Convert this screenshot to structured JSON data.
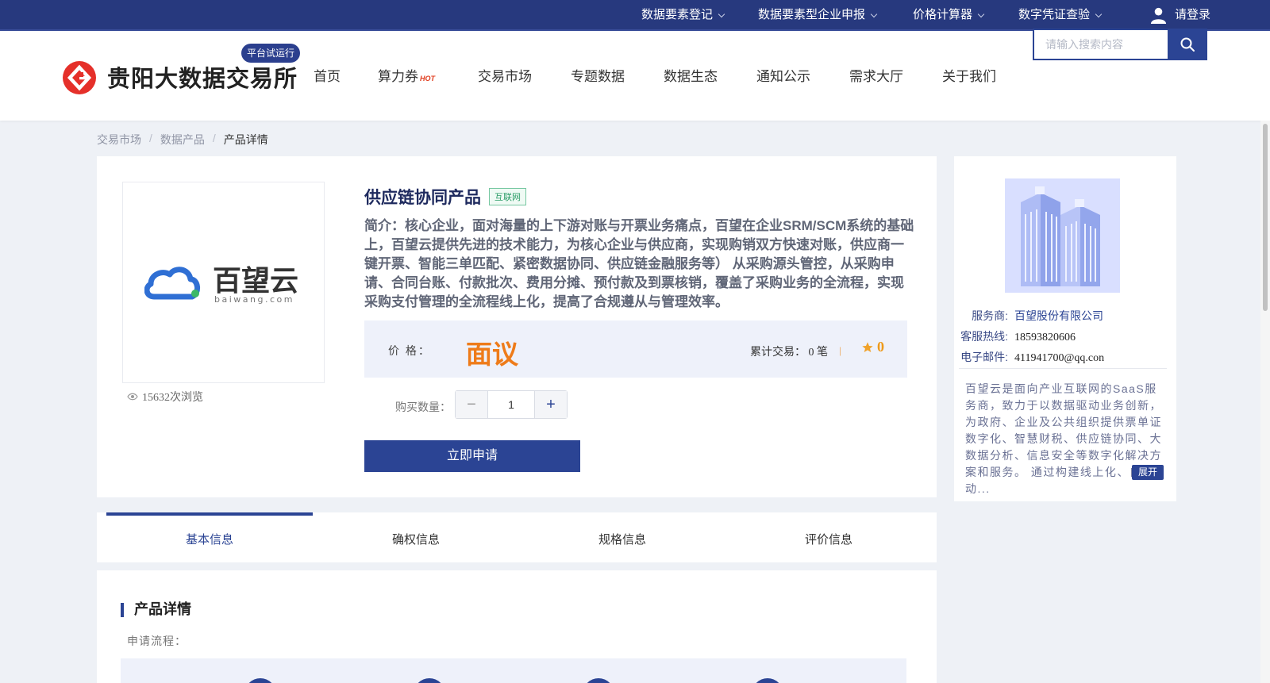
{
  "topbar": {
    "items": [
      {
        "label": "数据要素登记"
      },
      {
        "label": "数据要素型企业申报"
      },
      {
        "label": "价格计算器"
      },
      {
        "label": "数字凭证查验"
      }
    ],
    "login_label": "请登录"
  },
  "header": {
    "logo_text": "贵阳大数据交易所",
    "trial_badge": "平台试运行",
    "nav": [
      "首页",
      "算力券",
      "交易市场",
      "专题数据",
      "数据生态",
      "通知公示",
      "需求大厅",
      "关于我们"
    ],
    "nav_hot_badge": "HOT",
    "search_placeholder": "请输入搜索内容"
  },
  "breadcrumb": {
    "items": [
      "交易市场",
      "数据产品",
      "产品详情"
    ],
    "separator": "/"
  },
  "product": {
    "logo_text": "百望云",
    "logo_subtext": "baiwang.com",
    "views": "15632次浏览",
    "title": "供应链协同产品",
    "tag": "互联网",
    "description": "简介：核心企业，面对海量的上下游对账与开票业务痛点，百望在企业SRM/SCM系统的基础上，百望云提供先进的技术能力，为核心企业与供应商，实现购销双方快速对账，供应商一键开票、智能三单匹配、紧密数据协同、供应链金融服务等） 从采购源头管控，从采购申请、合同台账、付款批次、费用分摊、预付款及到票核销，覆盖了采购业务的全流程，实现采购支付管理的全流程线上化，提高了合规遵从与管理效率。",
    "price_label": "价 格：",
    "price_value": "面议",
    "trades": "累计交易： 0 笔",
    "separator": "|",
    "rating": "0",
    "quantity_label": "购买数量：",
    "quantity_value": "1",
    "minus": "−",
    "plus": "+",
    "apply_label": "立即申请"
  },
  "provider": {
    "name_label": "服务商:",
    "name_value": "百望股份有限公司",
    "phone_label": "客服热线:",
    "phone_value": "18593820606",
    "email_label": "电子邮件:",
    "email_value": "411941700@qq.con",
    "description": "百望云是面向产业互联网的SaaS服务商，致力于以数据驱动业务创新，为政府、企业及公共组织提供票单证数字化、智慧财税、供应链协同、大数据分析、信息安全等数字化解决方案和服务。 通过构建线上化、自动...",
    "expand_label": "展开"
  },
  "tabs": [
    {
      "label": "基本信息",
      "active": true
    },
    {
      "label": "确权信息",
      "active": false
    },
    {
      "label": "规格信息",
      "active": false
    },
    {
      "label": "评价信息",
      "active": false
    }
  ],
  "details": {
    "section_title": "产品详情",
    "flow_label": "申请流程："
  },
  "colors": {
    "primary": "#2b4494",
    "topbar": "#27397e",
    "price": "#ee7b19",
    "tag_green": "#2a9c66"
  }
}
